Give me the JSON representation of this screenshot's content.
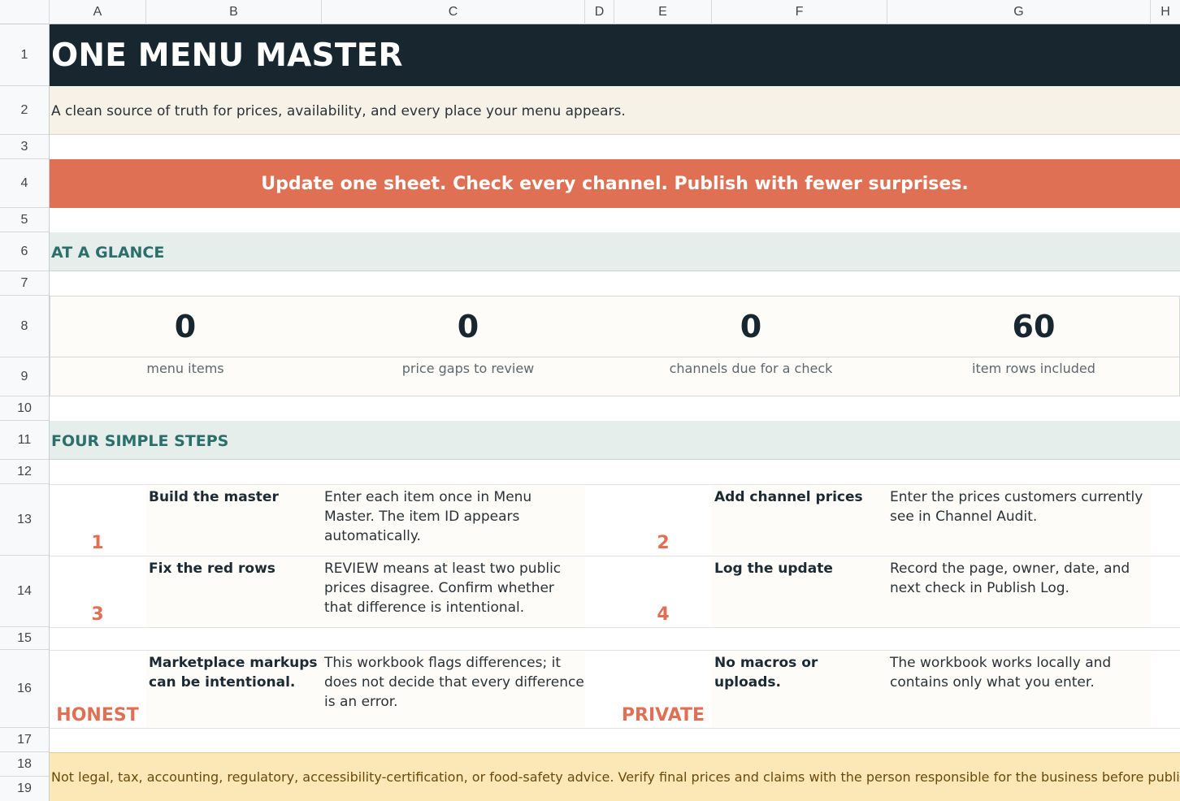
{
  "sheet": {
    "columns": [
      "A",
      "B",
      "C",
      "D",
      "E",
      "F",
      "G",
      "H"
    ],
    "rows": [
      "1",
      "2",
      "3",
      "4",
      "5",
      "6",
      "7",
      "8",
      "9",
      "10",
      "11",
      "12",
      "13",
      "14",
      "15",
      "16",
      "17",
      "18",
      "19"
    ]
  },
  "title": "ONE MENU MASTER",
  "subtitle": "A clean source of truth for prices, availability, and every place your menu appears.",
  "banner": "Update one sheet. Check every channel. Publish with fewer surprises.",
  "glance": {
    "heading": "AT A GLANCE",
    "stats": [
      {
        "value": "0",
        "label": "menu items"
      },
      {
        "value": "0",
        "label": "price gaps to review"
      },
      {
        "value": "0",
        "label": "channels due for a check"
      },
      {
        "value": "60",
        "label": "item rows included"
      }
    ]
  },
  "steps": {
    "heading": "FOUR SIMPLE STEPS",
    "items": [
      {
        "num": "1",
        "title": "Build the master",
        "desc": "Enter each item once in Menu Master. The item ID appears automatically."
      },
      {
        "num": "2",
        "title": "Add channel prices",
        "desc": "Enter the prices customers currently see in Channel Audit."
      },
      {
        "num": "3",
        "title": "Fix the red rows",
        "desc": "REVIEW means at least two public prices disagree. Confirm whether that difference is intentional."
      },
      {
        "num": "4",
        "title": "Log the update",
        "desc": "Record the page, owner, date, and next check in Publish Log."
      },
      {
        "num": "HONEST",
        "title": "Marketplace markups can be intentional.",
        "desc": "This workbook flags differences; it does not decide that every difference is an error."
      },
      {
        "num": "PRIVATE",
        "title": "No macros or uploads.",
        "desc": "The workbook works locally and contains only what you enter."
      }
    ]
  },
  "footer": "Not legal, tax, accounting, regulatory, accessibility-certification, or food-safety advice. Verify final prices and claims with the person responsible for the business before publishing.",
  "colors": {
    "title_bg": "#17262f",
    "banner_bg": "#e07054",
    "section_bg": "#e6eeec",
    "section_text": "#2b6e6a",
    "accent": "#e07054",
    "footer_bg": "#fbe8b6"
  }
}
